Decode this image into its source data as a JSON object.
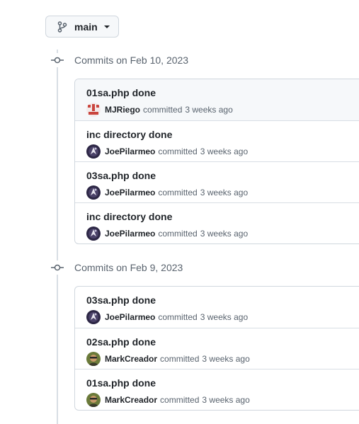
{
  "branch": {
    "label": "main"
  },
  "groups": [
    {
      "title": "Commits on Feb 10, 2023",
      "commits": [
        {
          "message": "01sa.php done",
          "author": "MJRiego",
          "verb": "committed",
          "when": "3 weeks ago",
          "avatar_icon": "mjriego-avatar"
        },
        {
          "message": "inc directory done",
          "author": "JoePilarmeo",
          "verb": "committed",
          "when": "3 weeks ago",
          "avatar_icon": "joepilarmeo-avatar"
        },
        {
          "message": "03sa.php done",
          "author": "JoePilarmeo",
          "verb": "committed",
          "when": "3 weeks ago",
          "avatar_icon": "joepilarmeo-avatar"
        },
        {
          "message": "inc directory done",
          "author": "JoePilarmeo",
          "verb": "committed",
          "when": "3 weeks ago",
          "avatar_icon": "joepilarmeo-avatar"
        }
      ]
    },
    {
      "title": "Commits on Feb 9, 2023",
      "commits": [
        {
          "message": "03sa.php done",
          "author": "JoePilarmeo",
          "verb": "committed",
          "when": "3 weeks ago",
          "avatar_icon": "joepilarmeo-avatar"
        },
        {
          "message": "02sa.php done",
          "author": "MarkCreador",
          "verb": "committed",
          "when": "3 weeks ago",
          "avatar_icon": "markcreador-avatar"
        },
        {
          "message": "01sa.php done",
          "author": "MarkCreador",
          "verb": "committed",
          "when": "3 weeks ago",
          "avatar_icon": "markcreador-avatar"
        }
      ]
    }
  ]
}
